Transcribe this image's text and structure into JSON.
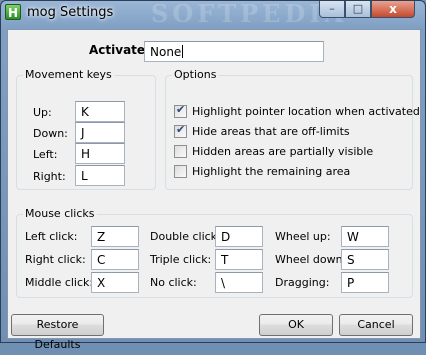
{
  "window": {
    "title": "mog Settings",
    "app_icon_glyph": "H",
    "watermark": "SOFTPEDIA",
    "minimize_glyph": "–",
    "maximize_glyph": "□",
    "close_glyph": "x"
  },
  "activate": {
    "label": "Activate:",
    "value": "None"
  },
  "movement": {
    "title": "Movement keys",
    "keys": [
      {
        "label": "Up:",
        "value": "K"
      },
      {
        "label": "Down:",
        "value": "J"
      },
      {
        "label": "Left:",
        "value": "H"
      },
      {
        "label": "Right:",
        "value": "L"
      }
    ]
  },
  "options": {
    "title": "Options",
    "items": [
      {
        "label": "Highlight pointer location when activated",
        "checked": true
      },
      {
        "label": "Hide areas that are off-limits",
        "checked": true
      },
      {
        "label": "Hidden areas are partially visible",
        "checked": false
      },
      {
        "label": "Highlight the remaining area",
        "checked": false
      }
    ]
  },
  "mouse": {
    "title": "Mouse clicks",
    "left_click": {
      "label": "Left click:",
      "value": "Z"
    },
    "right_click": {
      "label": "Right click:",
      "value": "C"
    },
    "middle_click": {
      "label": "Middle click:",
      "value": "X"
    },
    "double_click": {
      "label": "Double click:",
      "value": "D"
    },
    "triple_click": {
      "label": "Triple click:",
      "value": "T"
    },
    "no_click": {
      "label": "No click:",
      "value": "\\"
    },
    "wheel_up": {
      "label": "Wheel up:",
      "value": "W"
    },
    "wheel_down": {
      "label": "Wheel down:",
      "value": "S"
    },
    "dragging": {
      "label": "Dragging:",
      "value": "P"
    }
  },
  "buttons": {
    "restore": "Restore Defaults",
    "ok": "OK",
    "cancel": "Cancel"
  }
}
